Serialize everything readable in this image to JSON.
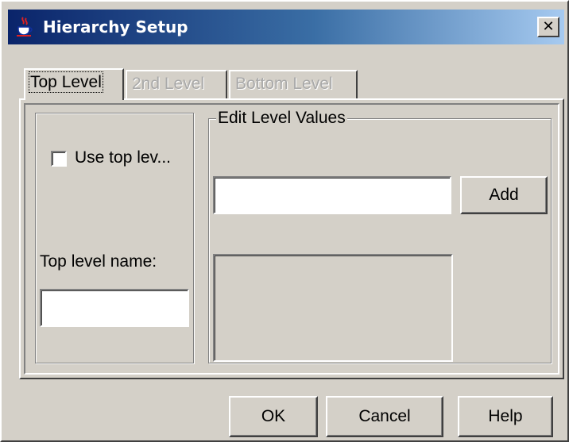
{
  "window": {
    "title": "Hierarchy Setup",
    "close_symbol": "✕"
  },
  "tabs": [
    {
      "label": "Top Level",
      "state": "active"
    },
    {
      "label": "2nd Level",
      "state": "disabled"
    },
    {
      "label": "Bottom Level",
      "state": "disabled"
    }
  ],
  "top_level": {
    "use_top_level_checkbox_label": "Use top lev...",
    "use_top_level_checked": false,
    "name_label": "Top level name:",
    "name_value": ""
  },
  "edit_level_values": {
    "group_title": "Edit Level Values",
    "input_value": "",
    "add_button": "Add",
    "values_list": []
  },
  "footer": {
    "ok_button": "OK",
    "cancel_button": "Cancel",
    "help_button": "Help"
  },
  "colors": {
    "title_gradient_start": "#0a246a",
    "title_gradient_end": "#a6caf0",
    "dialog_background": "#d4d0c8"
  },
  "icons": {
    "title_icon": "java-coffee-cup-icon",
    "close_icon": "close-icon"
  }
}
